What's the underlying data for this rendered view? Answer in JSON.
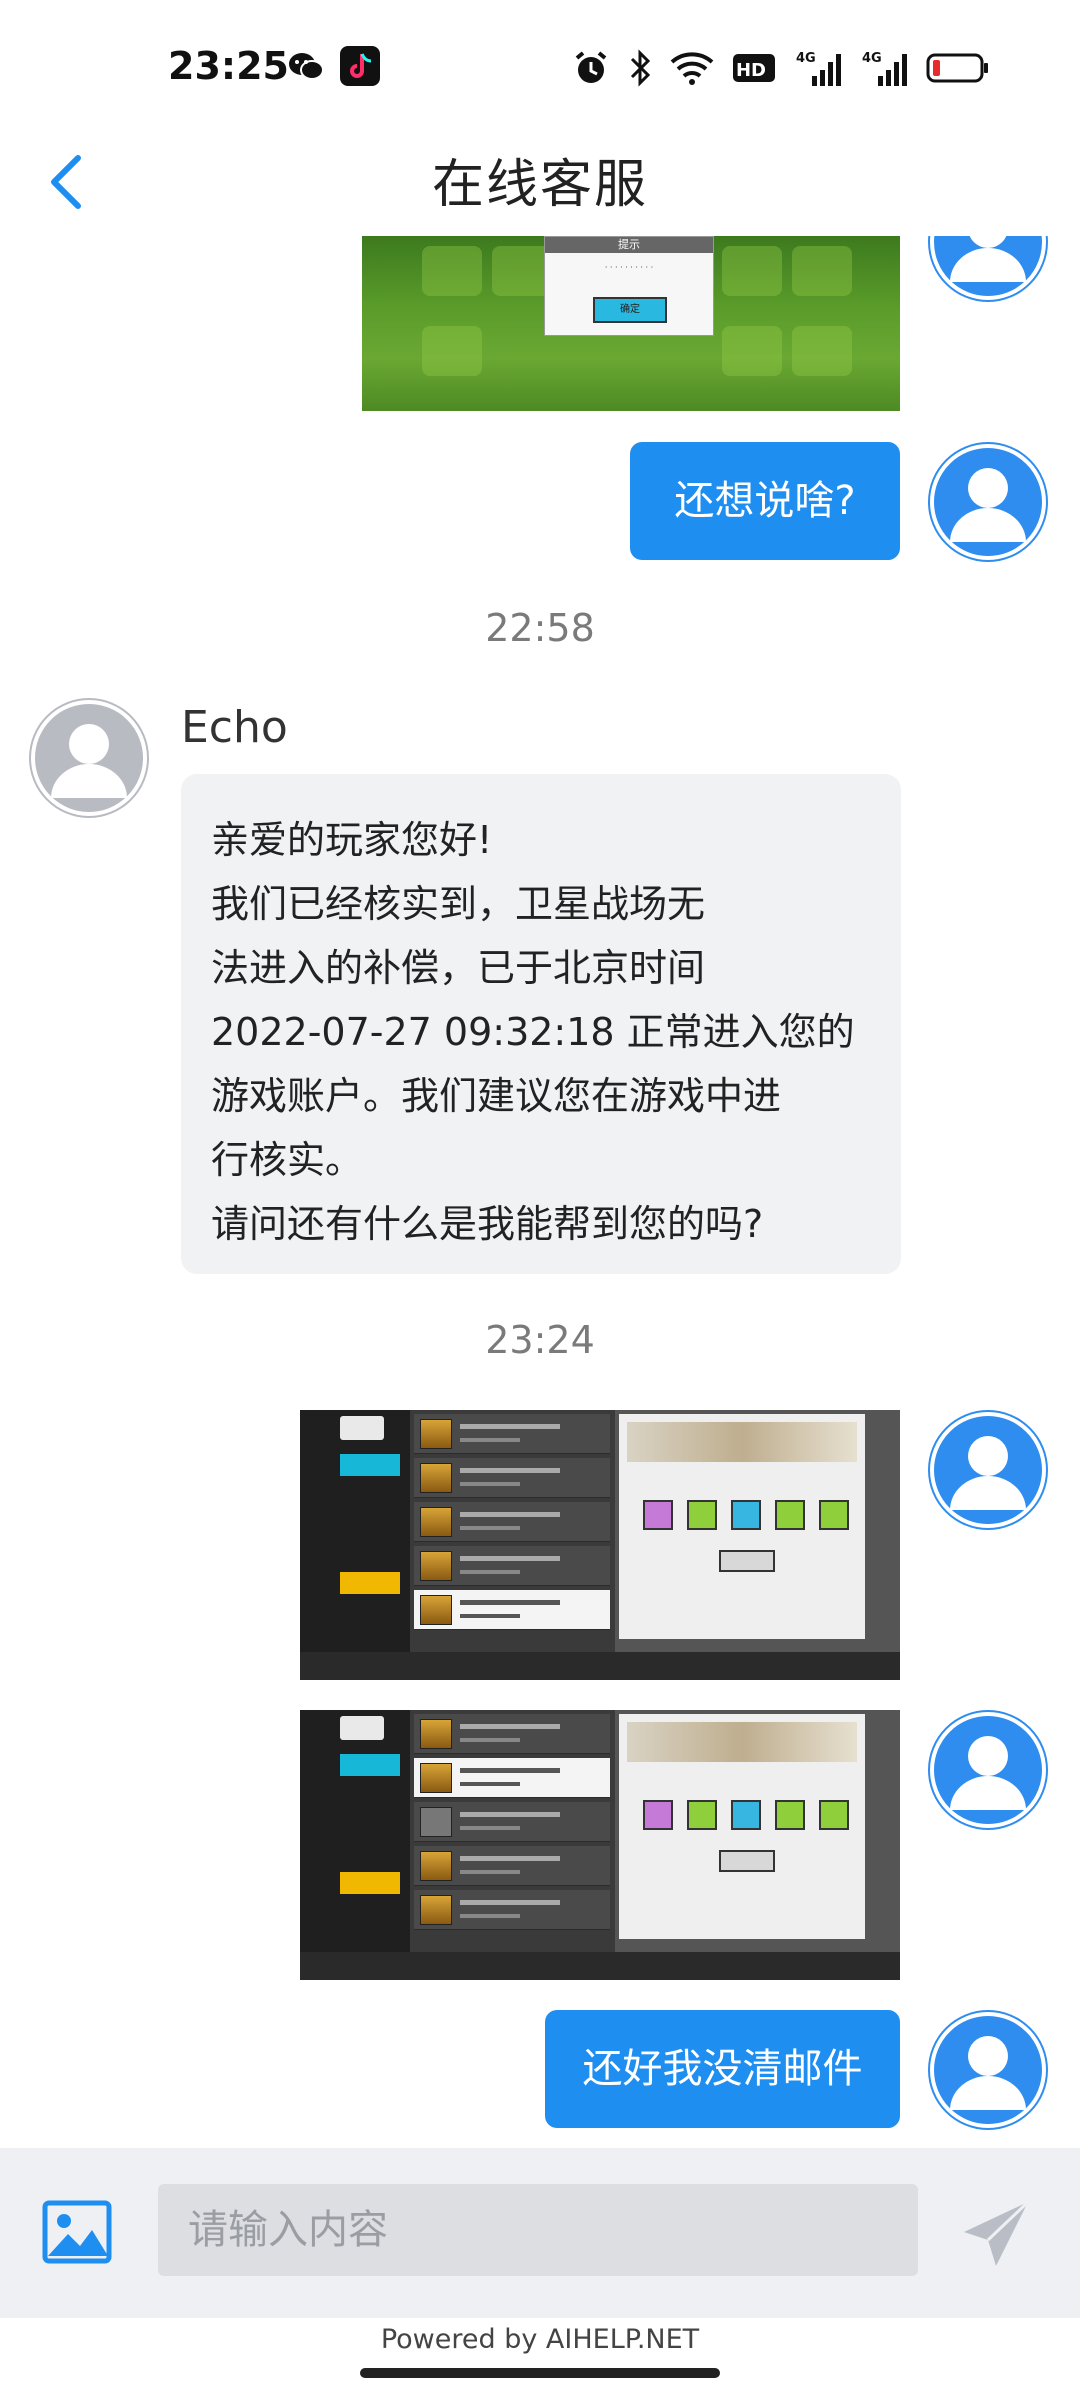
{
  "status_bar": {
    "time": "23:25",
    "icons": [
      "wechat-icon",
      "tiktok-icon",
      "alarm-icon",
      "bluetooth-icon",
      "wifi-icon",
      "hd-icon",
      "signal-4g-icon",
      "signal-4g-icon",
      "battery-low-icon"
    ],
    "hd_label": "HD",
    "net1": "4G",
    "net2": "4G"
  },
  "header": {
    "title": "在线客服",
    "back_icon": "chevron-left-icon"
  },
  "colors": {
    "accent": "#1f8ef1",
    "agent_bubble": "#f1f2f4",
    "input_bar": "#eef0f3"
  },
  "messages": {
    "top_image_dialog_title": "提示",
    "top_image_dialog_button": "确定",
    "user_text_1": "还想说啥?",
    "time_1": "22:58",
    "agent_name": "Echo",
    "agent_lines": [
      "亲爱的玩家您好!",
      "我们已经核实到，卫星战场无",
      "法进入的补偿，已于北京时间",
      "2022-07-27 09:32:18 正常进入您的",
      "游戏账户。我们建议您在游戏中进",
      "行核实。",
      "请问还有什么是我能帮到您的吗?"
    ],
    "time_2": "23:24",
    "user_text_2": "还好我没清邮件"
  },
  "input": {
    "placeholder": "请输入内容",
    "image_icon": "image-icon",
    "send_icon": "send-icon"
  },
  "footer": {
    "powered_by": "Powered by AIHELP.NET"
  }
}
